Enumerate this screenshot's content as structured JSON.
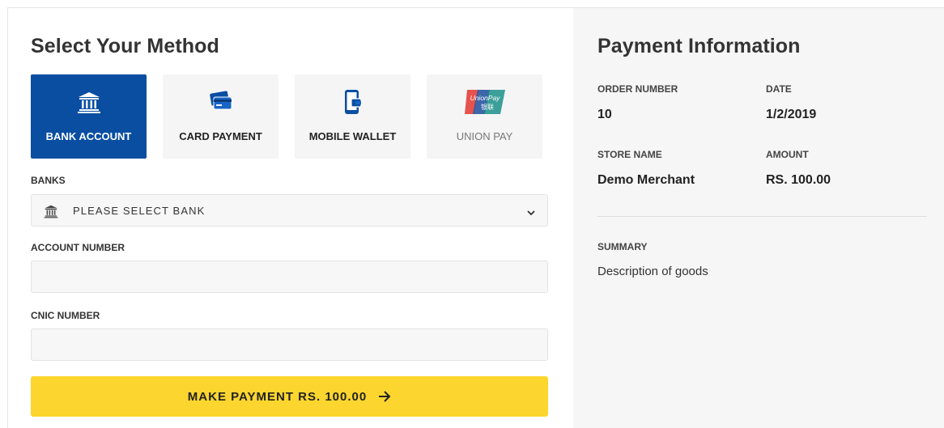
{
  "left": {
    "title": "Select Your Method",
    "methods": [
      {
        "label": "BANK ACCOUNT",
        "icon": "bank-icon",
        "active": true
      },
      {
        "label": "CARD PAYMENT",
        "icon": "credit-card-icon",
        "active": false
      },
      {
        "label": "MOBILE WALLET",
        "icon": "mobile-wallet-icon",
        "active": false
      },
      {
        "label": "UNION PAY",
        "icon": "unionpay-logo",
        "active": false
      }
    ],
    "banks_label": "BANKS",
    "bank_select": "PLEASE SELECT BANK",
    "account_label": "ACCOUNT NUMBER",
    "account_value": "",
    "cnic_label": "CNIC NUMBER",
    "cnic_value": "",
    "pay_button": "MAKE PAYMENT RS. 100.00"
  },
  "right": {
    "title": "Payment Information",
    "order_label": "ORDER NUMBER",
    "order_value": "10",
    "date_label": "DATE",
    "date_value": "1/2/2019",
    "store_label": "STORE NAME",
    "store_value": "Demo Merchant",
    "amount_label": "AMOUNT",
    "amount_value": "RS. 100.00",
    "summary_label": "SUMMARY",
    "summary_value": "Description of goods"
  },
  "colors": {
    "accent_blue": "#0a4ea2",
    "pay_yellow": "#fcd62e",
    "panel_gray": "#f6f6f6"
  },
  "unionpay_logo_text": "UnionPay 银联"
}
